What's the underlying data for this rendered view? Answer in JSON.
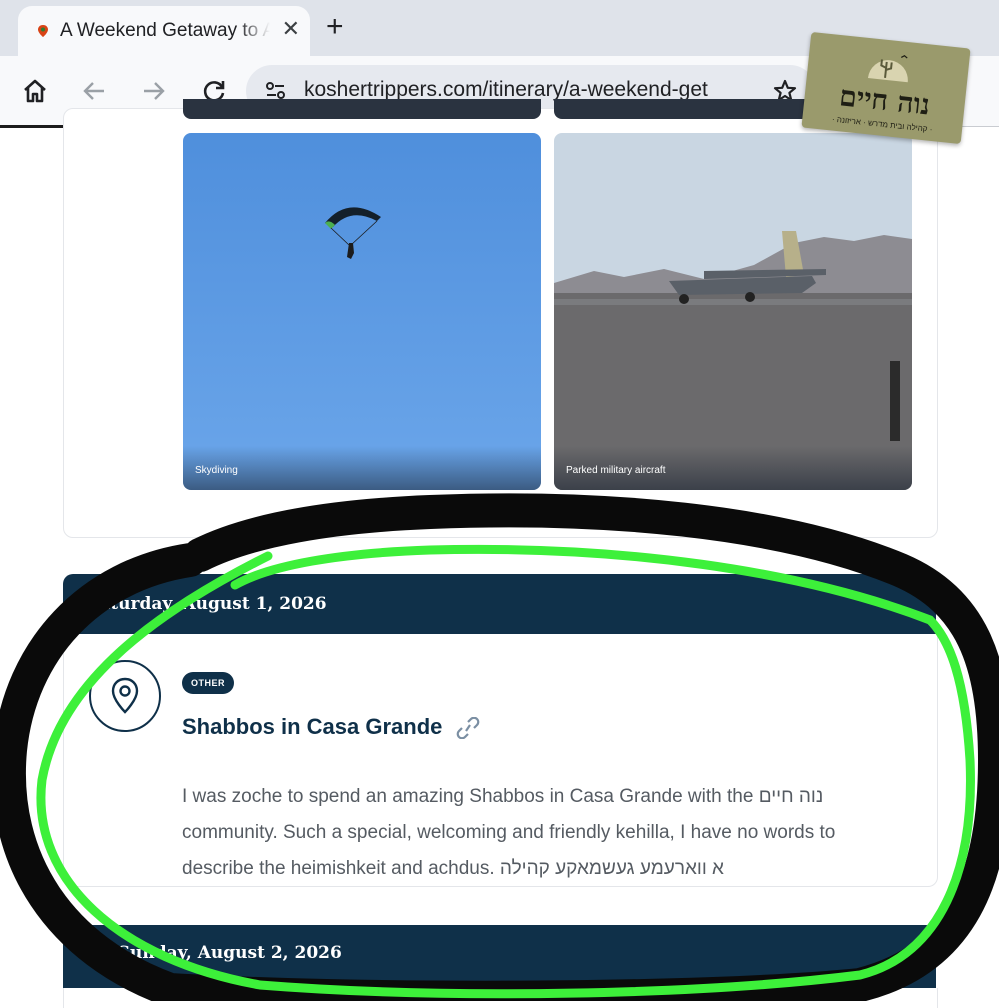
{
  "browser": {
    "tab_title": "A Weekend Getaway to A",
    "url": "koshertrippers.com/itinerary/a-weekend-get",
    "icons": [
      "home-icon",
      "back-icon",
      "forward-icon",
      "reload-icon",
      "site-settings-icon",
      "star-icon",
      "close-icon",
      "plus-icon"
    ]
  },
  "sticker": {
    "main_text": "נוה חיים",
    "sub_text": "· קהילה ובית מדרש · אריזונה ·"
  },
  "photos": [
    {
      "caption": "Skydiving"
    },
    {
      "caption": "Parked military aircraft"
    }
  ],
  "day1": {
    "header": "Saturday, August 1, 2026"
  },
  "event": {
    "badge": "OTHER",
    "title": "Shabbos in Casa Grande",
    "description": "I was zoche to spend an amazing Shabbos in Casa Grande with the נוה חיים community. Such a special, welcoming and friendly kehilla, I have no words to describe the heimishkeit and achdus. א ווארעמע געשמאקע קהילה"
  },
  "day2": {
    "header": "1 - Sunday, August 2, 2026"
  },
  "colors": {
    "navy": "#0f3049",
    "annotation_green": "#3df03a",
    "annotation_black": "#0a0a0a"
  }
}
